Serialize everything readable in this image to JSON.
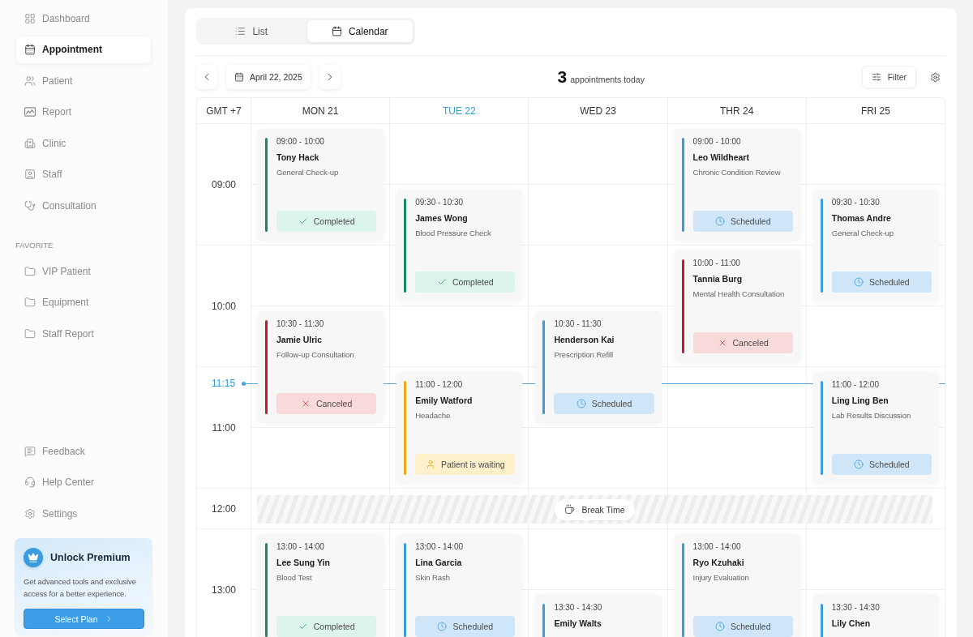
{
  "sidebar": {
    "nav_items": [
      {
        "label": "Dashboard",
        "selected": false
      },
      {
        "label": "Appointment",
        "selected": true
      },
      {
        "label": "Patient",
        "selected": false
      },
      {
        "label": "Report",
        "selected": false
      },
      {
        "label": "Clinic",
        "selected": false
      },
      {
        "label": "Staff",
        "selected": false
      },
      {
        "label": "Consultation",
        "selected": false
      }
    ],
    "favorite_heading": "FAVORITE",
    "favorites": [
      {
        "label": "VIP Patient",
        "selected": false
      },
      {
        "label": "Equipment",
        "selected": false
      },
      {
        "label": "Staff Report",
        "selected": false
      }
    ],
    "footer_items": [
      {
        "label": "Feedback",
        "selected": false
      },
      {
        "label": "Help Center",
        "selected": false
      },
      {
        "label": "Settings",
        "selected": false
      }
    ],
    "premium": {
      "title": "Unlock Premium",
      "description": "Get advanced tools and exclusive access for a better experience.",
      "button": "Select Plan"
    }
  },
  "view_tabs": [
    {
      "label": "List",
      "selected": false
    },
    {
      "label": "Calendar",
      "selected": true
    }
  ],
  "toolbar": {
    "date": "April 22, 2025",
    "count": "3",
    "count_label": "appointments today",
    "filter": "Filter"
  },
  "calendar": {
    "timezone": "GMT +7",
    "now": "11:15",
    "hours": [
      {
        "label": "09:00",
        "kind": "hour"
      },
      {
        "label": "10:00",
        "kind": "hour"
      },
      {
        "label": "11:00",
        "kind": "hour"
      },
      {
        "label": "12:00",
        "kind": "break",
        "title": "Break Time"
      },
      {
        "label": "13:00",
        "kind": "hour"
      }
    ],
    "days": [
      {
        "label": "MON 21",
        "today": false,
        "appointments": [
          {
            "time": "09:00 - 10:00",
            "name": "Tony Hack",
            "reason": "General Check-up",
            "color": "#1f8a5c",
            "status": {
              "kind": "completed",
              "label": "Completed"
            }
          },
          {
            "time": "10:30 - 11:30",
            "name": "Jamie Ulric",
            "reason": "Follow-up Consultation",
            "color": "#c41f26",
            "status": {
              "kind": "canceled",
              "label": "Canceled"
            }
          },
          {
            "time": "13:00 - 14:00",
            "name": "Lee Sung Yin",
            "reason": "Blood Test",
            "color": "#1f8a5c",
            "status": {
              "kind": "completed",
              "label": "Completed"
            }
          }
        ]
      },
      {
        "label": "TUE 22",
        "today": true,
        "appointments": [
          {
            "time": "09:30 - 10:30",
            "name": "James Wong",
            "reason": "Blood Pressure Check",
            "color": "#1f8a5c",
            "status": {
              "kind": "completed",
              "label": "Completed"
            }
          },
          {
            "time": "11:00 - 12:00",
            "name": "Emily Watford",
            "reason": "Headache",
            "color": "#e8a917",
            "status": {
              "kind": "waiting",
              "label": "Patient is waiting"
            }
          },
          {
            "time": "13:00 - 14:00",
            "name": "Lina Garcia",
            "reason": "Skin Rash",
            "color": "#3d9bd8",
            "status": {
              "kind": "scheduled",
              "label": "Scheduled"
            }
          }
        ]
      },
      {
        "label": "WED 23",
        "today": false,
        "appointments": [
          {
            "time": "10:30 - 11:30",
            "name": "Henderson Kai",
            "reason": "Prescription Refill",
            "color": "#3d9bd8",
            "status": {
              "kind": "scheduled",
              "label": "Scheduled"
            }
          },
          {
            "time": "13:30 - 14:30",
            "name": "Emily Walts",
            "color": "#3d9bd8"
          }
        ]
      },
      {
        "label": "THR 24",
        "today": false,
        "appointments": [
          {
            "time": "09:00 - 10:00",
            "name": "Leo Wildheart",
            "reason": "Chronic Condition Review",
            "color": "#3d9bd8",
            "status": {
              "kind": "scheduled",
              "label": "Scheduled"
            }
          },
          {
            "time": "10:00 - 11:00",
            "name": "Tannia Burg",
            "reason": "Mental Health Consultation",
            "color": "#c41f26",
            "status": {
              "kind": "canceled",
              "label": "Canceled"
            }
          },
          {
            "time": "13:00 - 14:00",
            "name": "Ryo Kzuhaki",
            "reason": "Injury Evaluation",
            "color": "#3d9bd8",
            "status": {
              "kind": "scheduled",
              "label": "Scheduled"
            }
          }
        ]
      },
      {
        "label": "FRI 25",
        "today": false,
        "appointments": [
          {
            "time": "09:30 - 10:30",
            "name": "Thomas Andre",
            "reason": "General Check-up",
            "color": "#3d9bd8",
            "status": {
              "kind": "scheduled",
              "label": "Scheduled"
            }
          },
          {
            "time": "11:00 - 12:00",
            "name": "Ling Ling Ben",
            "reason": "Lab Results Discussion",
            "color": "#3d9bd8",
            "status": {
              "kind": "scheduled",
              "label": "Scheduled"
            }
          },
          {
            "time": "13:30 - 14:30",
            "name": "Lily Chen",
            "color": "#3d9bd8"
          }
        ]
      }
    ]
  }
}
